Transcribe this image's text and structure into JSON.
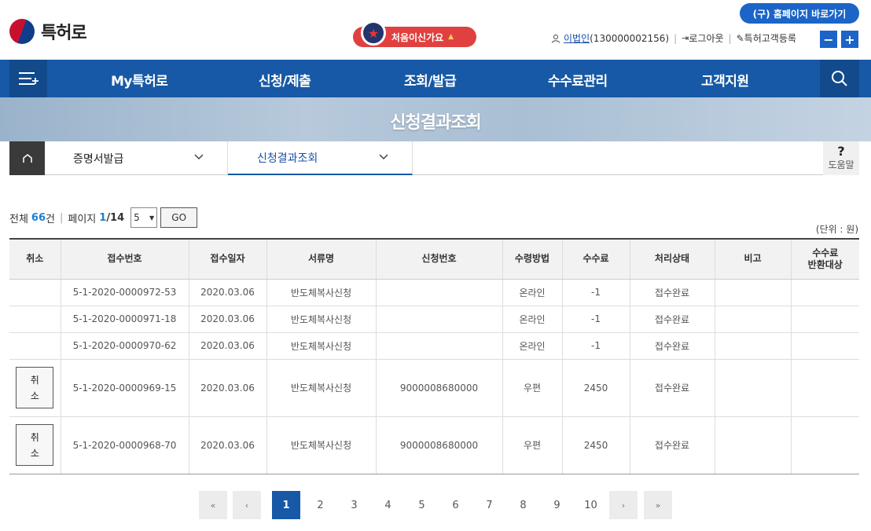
{
  "header": {
    "logo_text": "특허로",
    "first_visit": "처음이신가요",
    "home_link": "(구) 홈페이지 바로가기",
    "user_name": "이법인",
    "user_id": "(130000002156)",
    "logout": "로그아웃",
    "customer_register": "특허고객등록",
    "zoom_out": "−",
    "zoom_in": "+"
  },
  "nav": {
    "items": [
      "My특허로",
      "신청/제출",
      "조회/발급",
      "수수료관리",
      "고객지원"
    ]
  },
  "banner": {
    "title": "신청결과조회"
  },
  "breadcrumb": {
    "level1": "증명서발급",
    "level2": "신청결과조회",
    "help": "도움말",
    "help_mark": "?"
  },
  "summary": {
    "total_label": "전체",
    "total_count": "66",
    "total_unit": "건",
    "page_label": "페이지",
    "page_current": "1",
    "page_total": "/14",
    "page_size": "5",
    "go": "GO",
    "unit": "(단위 : 원)"
  },
  "table": {
    "headers": [
      "취소",
      "접수번호",
      "접수일자",
      "서류명",
      "신청번호",
      "수령방법",
      "수수료",
      "처리상태",
      "비고",
      "수수료\n반환대상"
    ],
    "rows": [
      {
        "cancel": "",
        "receipt_no": "5-1-2020-0000972-53",
        "date": "2020.03.06",
        "doc": "반도체복사신청",
        "app_no": "",
        "method": "온라인",
        "fee": "-1",
        "status": "접수완료",
        "note": "",
        "refund": ""
      },
      {
        "cancel": "",
        "receipt_no": "5-1-2020-0000971-18",
        "date": "2020.03.06",
        "doc": "반도체복사신청",
        "app_no": "",
        "method": "온라인",
        "fee": "-1",
        "status": "접수완료",
        "note": "",
        "refund": ""
      },
      {
        "cancel": "",
        "receipt_no": "5-1-2020-0000970-62",
        "date": "2020.03.06",
        "doc": "반도체복사신청",
        "app_no": "",
        "method": "온라인",
        "fee": "-1",
        "status": "접수완료",
        "note": "",
        "refund": ""
      },
      {
        "cancel": "취소",
        "receipt_no": "5-1-2020-0000969-15",
        "date": "2020.03.06",
        "doc": "반도체복사신청",
        "app_no": "9000008680000",
        "method": "우편",
        "fee": "2450",
        "status": "접수완료",
        "note": "",
        "refund": ""
      },
      {
        "cancel": "취소",
        "receipt_no": "5-1-2020-0000968-70",
        "date": "2020.03.06",
        "doc": "반도체복사신청",
        "app_no": "9000008680000",
        "method": "우편",
        "fee": "2450",
        "status": "접수완료",
        "note": "",
        "refund": ""
      }
    ],
    "cancel_line1": "취",
    "cancel_line2": "소"
  },
  "pager": {
    "first": "«",
    "prev": "‹",
    "pages": [
      "1",
      "2",
      "3",
      "4",
      "5",
      "6",
      "7",
      "8",
      "9",
      "10"
    ],
    "current": "1",
    "next": "›",
    "last": "»"
  }
}
